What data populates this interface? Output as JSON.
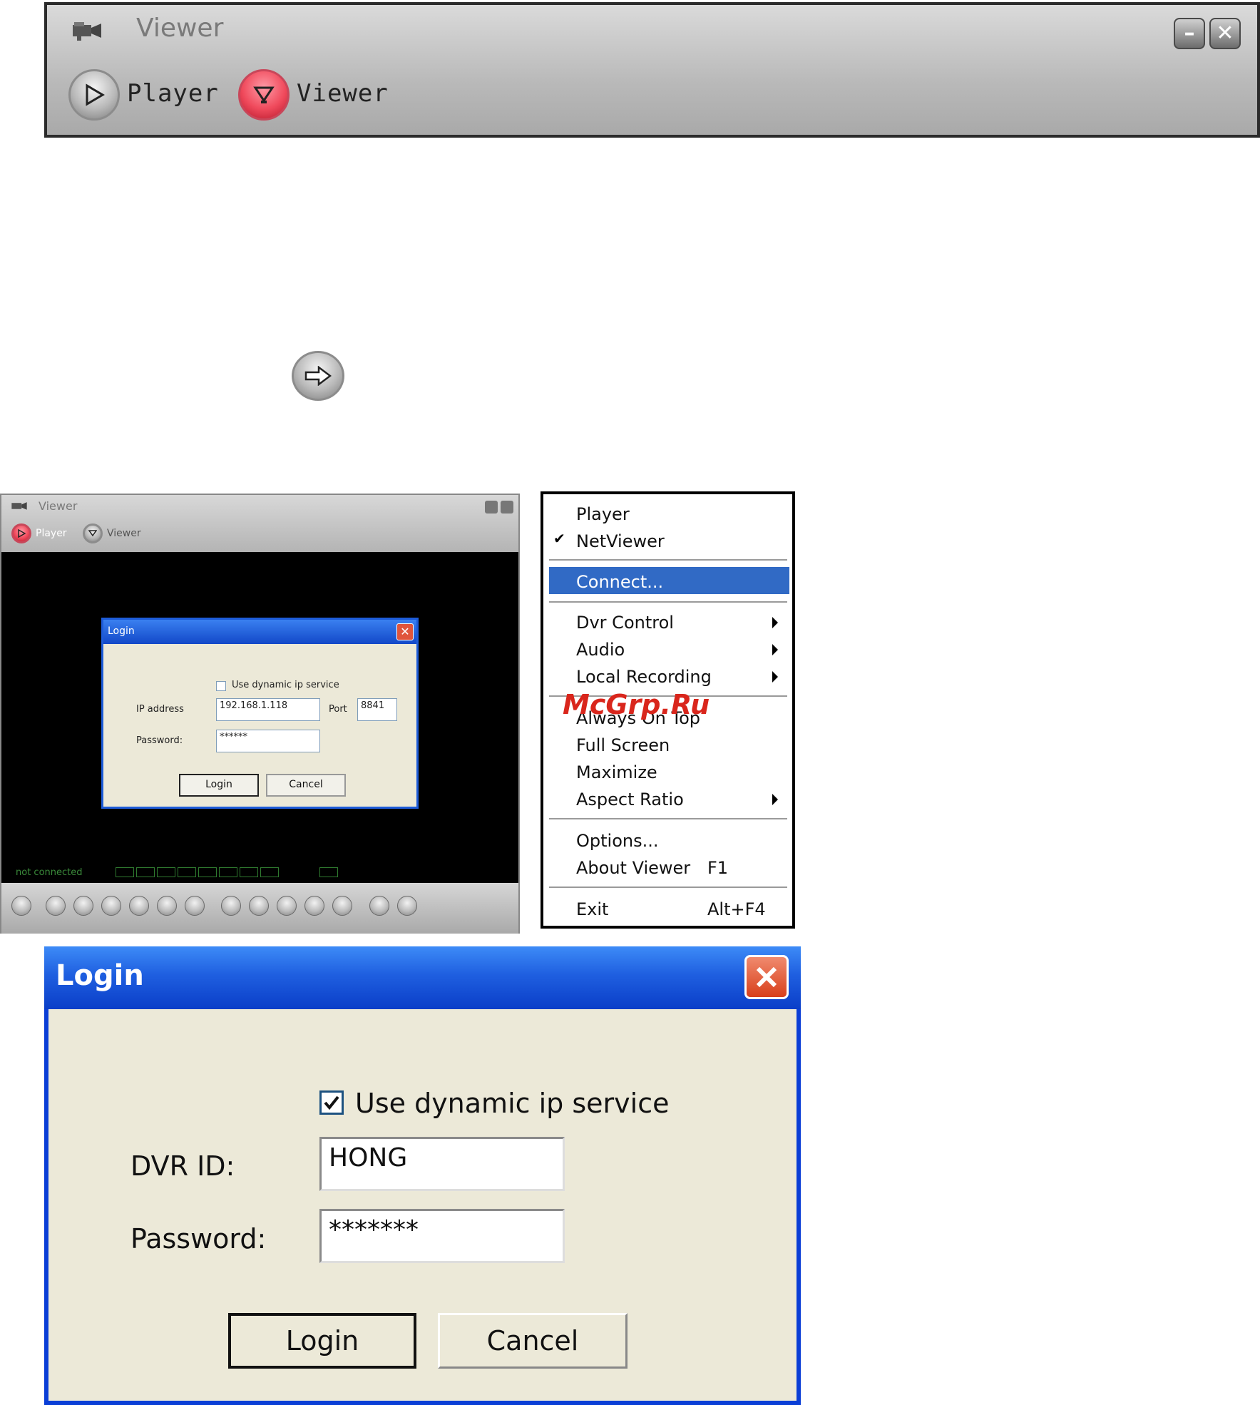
{
  "top_window": {
    "title": "Viewer",
    "tabs": [
      {
        "label": "Player"
      },
      {
        "label": "Viewer"
      }
    ],
    "minimize_icon": "minimize-icon",
    "close_icon": "close-icon"
  },
  "small_window": {
    "title": "Viewer",
    "tabs": [
      {
        "label": "Player"
      },
      {
        "label": "Viewer"
      }
    ],
    "status": "not connected",
    "login": {
      "title": "Login",
      "dynamic_ip_label": "Use dynamic ip service",
      "ip_label": "IP address",
      "ip_value": "192.168.1.118",
      "port_label": "Port",
      "port_value": "8841",
      "password_label": "Password:",
      "password_value": "******",
      "login_button": "Login",
      "cancel_button": "Cancel"
    }
  },
  "context_menu": {
    "items": [
      {
        "label": "Player"
      },
      {
        "label": "NetViewer",
        "checked": true
      },
      {
        "label": "Connect...",
        "highlighted": true
      },
      {
        "label": "Dvr Control",
        "submenu": true
      },
      {
        "label": "Audio",
        "submenu": true
      },
      {
        "label": "Local Recording",
        "submenu": true
      },
      {
        "label": "Always On Top"
      },
      {
        "label": "Full Screen"
      },
      {
        "label": "Maximize"
      },
      {
        "label": "Aspect Ratio",
        "submenu": true
      },
      {
        "label": "Options..."
      },
      {
        "label": "About Viewer",
        "shortcut": "F1"
      },
      {
        "label": "Exit",
        "shortcut": "Alt+F4"
      }
    ],
    "highlight_color": "#316ac5"
  },
  "login_dialog": {
    "title": "Login",
    "dynamic_ip_label": "Use dynamic ip service",
    "dynamic_ip_checked": true,
    "dvr_id_label": "DVR ID:",
    "dvr_id_value": "HONG",
    "password_label": "Password:",
    "password_value": "*******",
    "login_button": "Login",
    "cancel_button": "Cancel"
  },
  "watermark": "McGrp.Ru",
  "colors": {
    "xp_blue": "#0a3ed6",
    "dialog_bg": "#ece9d8",
    "record_red": "#f04a5c"
  }
}
